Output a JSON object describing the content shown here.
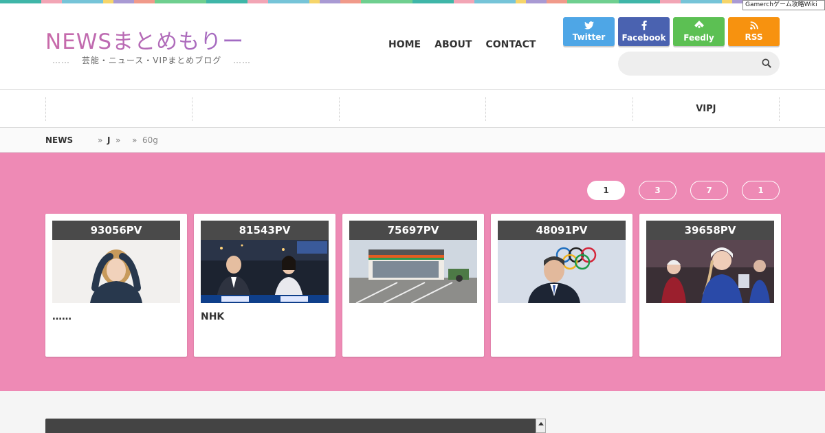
{
  "top_badge": "Gamerchゲーム攻略Wiki",
  "site": {
    "title": "NEWSまとめもりー",
    "tagline": "芸能・ニュース・VIPまとめブログ",
    "tagline_dots": "……"
  },
  "main_nav": [
    {
      "label": "HOME"
    },
    {
      "label": "ABOUT"
    },
    {
      "label": "CONTACT"
    }
  ],
  "social": [
    {
      "label": "Twitter",
      "icon": "twitter-bird-icon",
      "color": "#4ea6e6"
    },
    {
      "label": "Facebook",
      "icon": "facebook-f-icon",
      "color": "#4a62b0"
    },
    {
      "label": "Feedly",
      "icon": "feedly-icon",
      "color": "#5cc053"
    },
    {
      "label": "RSS",
      "icon": "rss-icon",
      "color": "#f7920f"
    }
  ],
  "search": {
    "placeholder": "",
    "icon": "search-icon"
  },
  "categories": [
    {
      "label": ""
    },
    {
      "label": ""
    },
    {
      "label": ""
    },
    {
      "label": ""
    },
    {
      "label": "VIPJ"
    }
  ],
  "breadcrumb": {
    "home": "NEWS",
    "sep": "»",
    "cat": "J",
    "current": "60g"
  },
  "ranking": {
    "background": "#ee8ab5",
    "tabs": [
      {
        "label": "1",
        "active": true
      },
      {
        "label": "3",
        "active": false
      },
      {
        "label": "7",
        "active": false
      },
      {
        "label": "1",
        "active": false
      }
    ],
    "cards": [
      {
        "pv": "93056PV",
        "title": "……"
      },
      {
        "pv": "81543PV",
        "title": "NHK"
      },
      {
        "pv": "75697PV",
        "title": ""
      },
      {
        "pv": "48091PV",
        "title": ""
      },
      {
        "pv": "39658PV",
        "title": ""
      }
    ]
  }
}
